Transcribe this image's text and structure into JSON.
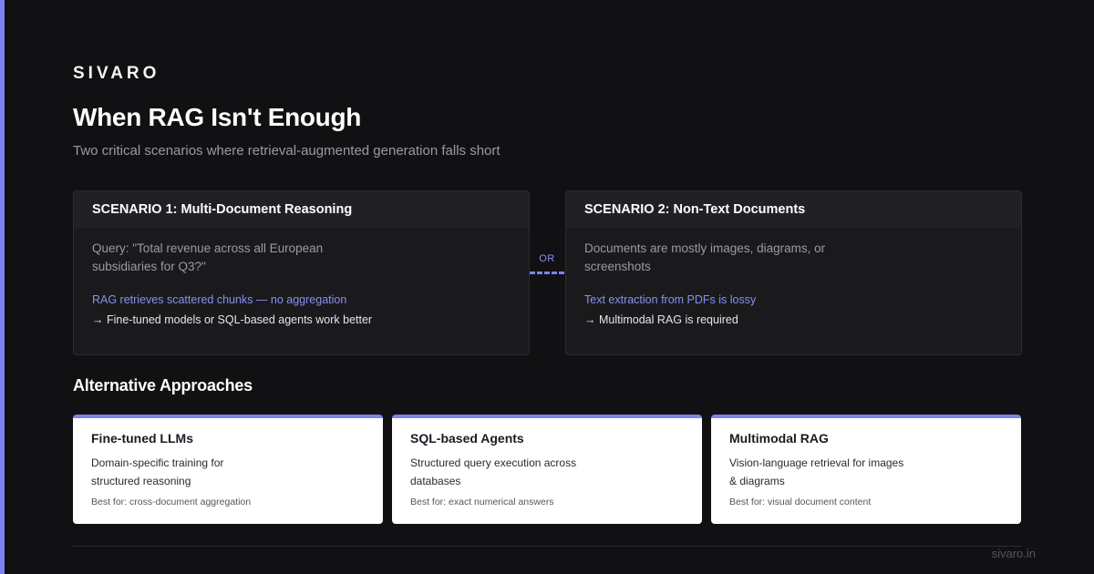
{
  "brand": "SIVARO",
  "title": "When RAG Isn't Enough",
  "subtitle": "Two critical scenarios where retrieval-augmented generation falls short",
  "scenarios": [
    {
      "title": "SCENARIO 1: Multi-Document Reasoning",
      "description": "Query: \"Total revenue across all European subsidiaries for Q3?\"",
      "problem": "RAG retrieves scattered chunks — no aggregation",
      "solution": "→ Fine-tuned models or SQL-based agents work better"
    },
    {
      "title": "SCENARIO 2: Non-Text Documents",
      "description": "Documents are mostly images, diagrams, or screenshots",
      "problem": "Text extraction from PDFs is lossy",
      "solution": "→ Multimodal RAG is required"
    }
  ],
  "connector_label": "OR",
  "alternatives": {
    "heading": "Alternative Approaches",
    "cards": [
      {
        "title": "Fine-tuned LLMs",
        "description": "Domain-specific training for structured reasoning",
        "best_for": "Best for: cross-document aggregation"
      },
      {
        "title": "SQL-based Agents",
        "description": "Structured query execution across databases",
        "best_for": "Best for: exact numerical answers"
      },
      {
        "title": "Multimodal RAG",
        "description": "Vision-language retrieval for images & diagrams",
        "best_for": "Best for: visual document content"
      }
    ]
  },
  "footer": {
    "url": "sivaro.in"
  },
  "colors": {
    "accent": "#7b83ee",
    "background": "#111113",
    "panel": "#1a1a1d",
    "highlight_text": "#8a90f0"
  }
}
